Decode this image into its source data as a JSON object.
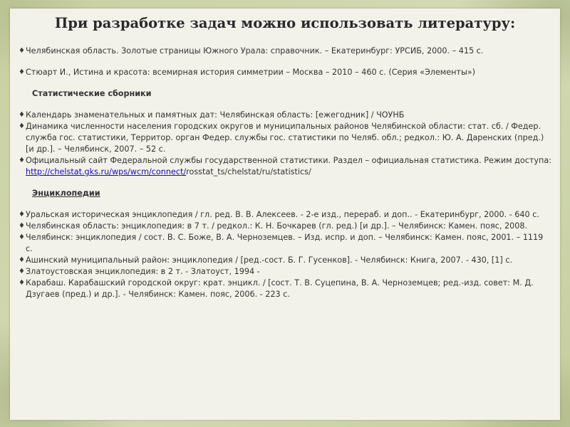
{
  "title": "При разработке задач можно использовать литературу:",
  "bullet_icon": "diamond-bullet",
  "entries": [
    "Челябинская область. Золотые страницы Южного Урала: справочник. – Екатеринбург: УРСИБ, 2000. – 415 с.",
    "Стюарт И., Истина и красота: всемирная история симметрии – Москва – 2010 – 460 с. (Серия «Элементы»)"
  ],
  "section_stat": {
    "heading": "Статистические сборники",
    "items": [
      "Календарь знаменательных и памятных дат: Челябинская область: [ежегодник] / ЧОУНБ",
      "Динамика численности населения городских округов и муниципальных районов Челябинской области: стат. сб. / Федер. служба гос. статистики, Территор. орган Федер. службы гос. статистики по Челяб. обл.; редкол.: Ю. А. Даренских (пред.) [и др.]. – Челябинск, 2007. – 52 с.",
      "Официальный сайт Федеральной службы государственной статистики. Раздел – официальная статистика. Режим доступа: "
    ],
    "link_text": "http://chelstat.gks.ru/wps/wcm/connect/",
    "link_suffix": "rosstat_ts/chelstat/ru/statistics/"
  },
  "section_enc": {
    "heading": "Энциклопедии",
    "items": [
      " Уральская историческая энциклопедия / гл. ред. В. В. Алексеев. - 2-е изд., перераб. и доп.. - Екатеринбург, 2000. - 640 с.",
      "Челябинская область: энциклопедия: в 7 т. / редкол.: К. Н. Бочкарев (гл. ред.) [и др.]. – Челябинск: Камен. пояс, 2008.",
      "Челябинск: энциклопедия / сост. В. С. Боже, В. А. Черноземцев. – Изд. испр. и доп. – Челябинск: Камен. пояс, 2001. – 1119 с.",
      "Ашинский муниципальный район: энциклопедия / [ред.-сост. Б. Г. Гусенков]. - Челябинск: Книга, 2007. - 430, [1] с.",
      "Златоустовская энциклопедия: в 2 т. - Златоуст, 1994 -",
      "Карабаш. Карабашский городской округ: крат. энцикл. / [сост. Т. В. Суцепина, В. А. Черноземцев; ред.-изд. совет: М. Д. Дзугаев (пред.) и др.]. - Челябинск: Камен. пояс, 2006. - 223 с."
    ]
  }
}
